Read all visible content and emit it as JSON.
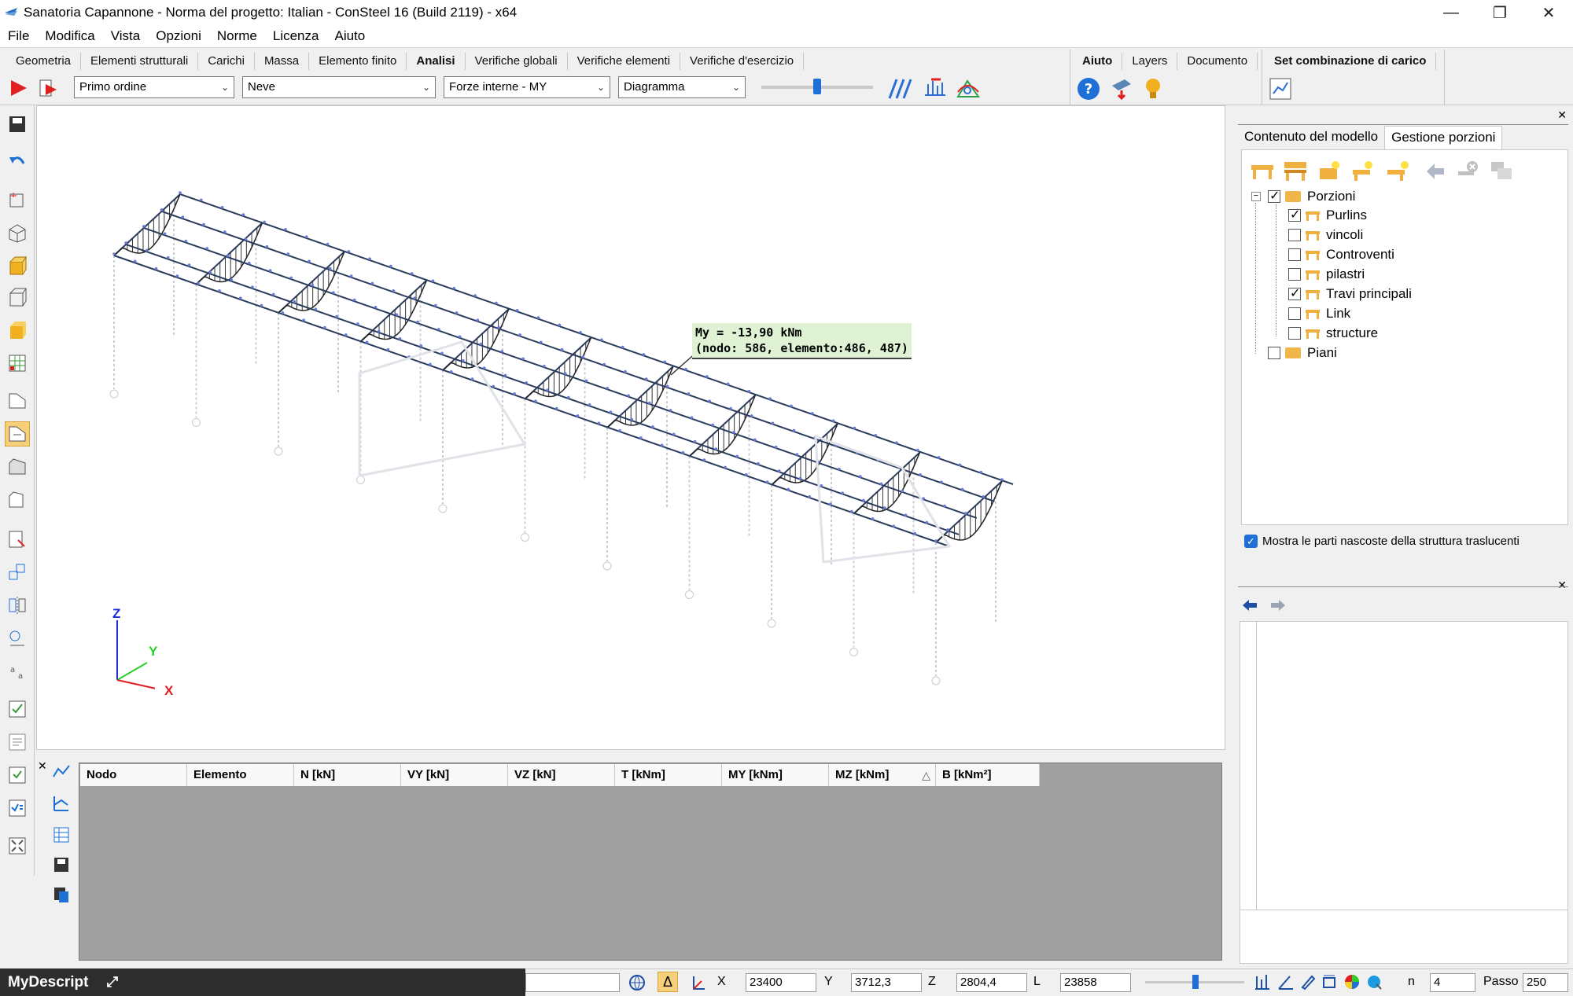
{
  "window": {
    "title": "Sanatoria Capannone - Norma del progetto: Italian - ConSteel 16 (Build 2119) - x64"
  },
  "menu": [
    "File",
    "Modifica",
    "Vista",
    "Opzioni",
    "Norme",
    "Licenza",
    "Aiuto"
  ],
  "ribbon": {
    "tabs": [
      "Geometria",
      "Elementi strutturali",
      "Carichi",
      "Massa",
      "Elemento finito",
      "Analisi",
      "Verifiche globali",
      "Verifiche elementi",
      "Verifiche d'esercizio"
    ],
    "active_tab": "Analisi",
    "right_tabs": [
      "Aiuto",
      "Layers",
      "Documento"
    ],
    "combo_tab": "Set combinazione di carico",
    "analysis_order": "Primo ordine",
    "load_case": "Neve",
    "result_type": "Forze interne - MY",
    "display_mode": "Diagramma"
  },
  "viewport": {
    "tooltip_line1": "My = -13,90 kNm",
    "tooltip_line2": "(nodo: 586, elemento:486, 487)",
    "axes": {
      "z": "Z",
      "y": "Y",
      "x": "X"
    }
  },
  "table": {
    "columns": [
      "Nodo",
      "Elemento",
      "N [kN]",
      "VY [kN]",
      "VZ [kN]",
      "T [kNm]",
      "MY [kNm]",
      "MZ [kNm]",
      "B [kNm²]"
    ],
    "rows": []
  },
  "right_panel": {
    "tabs": [
      "Contenuto del modello",
      "Gestione porzioni"
    ],
    "active_tab": "Gestione porzioni",
    "tree": {
      "root": {
        "label": "Porzioni",
        "checked": true
      },
      "items": [
        {
          "label": "Purlins",
          "checked": true
        },
        {
          "label": "vincoli",
          "checked": false
        },
        {
          "label": "Controventi",
          "checked": false
        },
        {
          "label": "pilastri",
          "checked": false
        },
        {
          "label": "Travi principali",
          "checked": true
        },
        {
          "label": "Link",
          "checked": false
        },
        {
          "label": "structure",
          "checked": false
        }
      ],
      "second_root": {
        "label": "Piani",
        "checked": false
      }
    },
    "show_hidden_label": "Mostra le parti nascoste della struttura traslucenti",
    "show_hidden_checked": true
  },
  "statusbar": {
    "script_label": "MyDescript",
    "x_label": "X",
    "x_value": "23400",
    "y_label": "Y",
    "y_value": "3712,3",
    "z_label": "Z",
    "z_value": "2804,4",
    "l_label": "L",
    "l_value": "23858",
    "n_label": "n",
    "n_value": "4",
    "passo_label": "Passo",
    "passo_value": "250"
  }
}
